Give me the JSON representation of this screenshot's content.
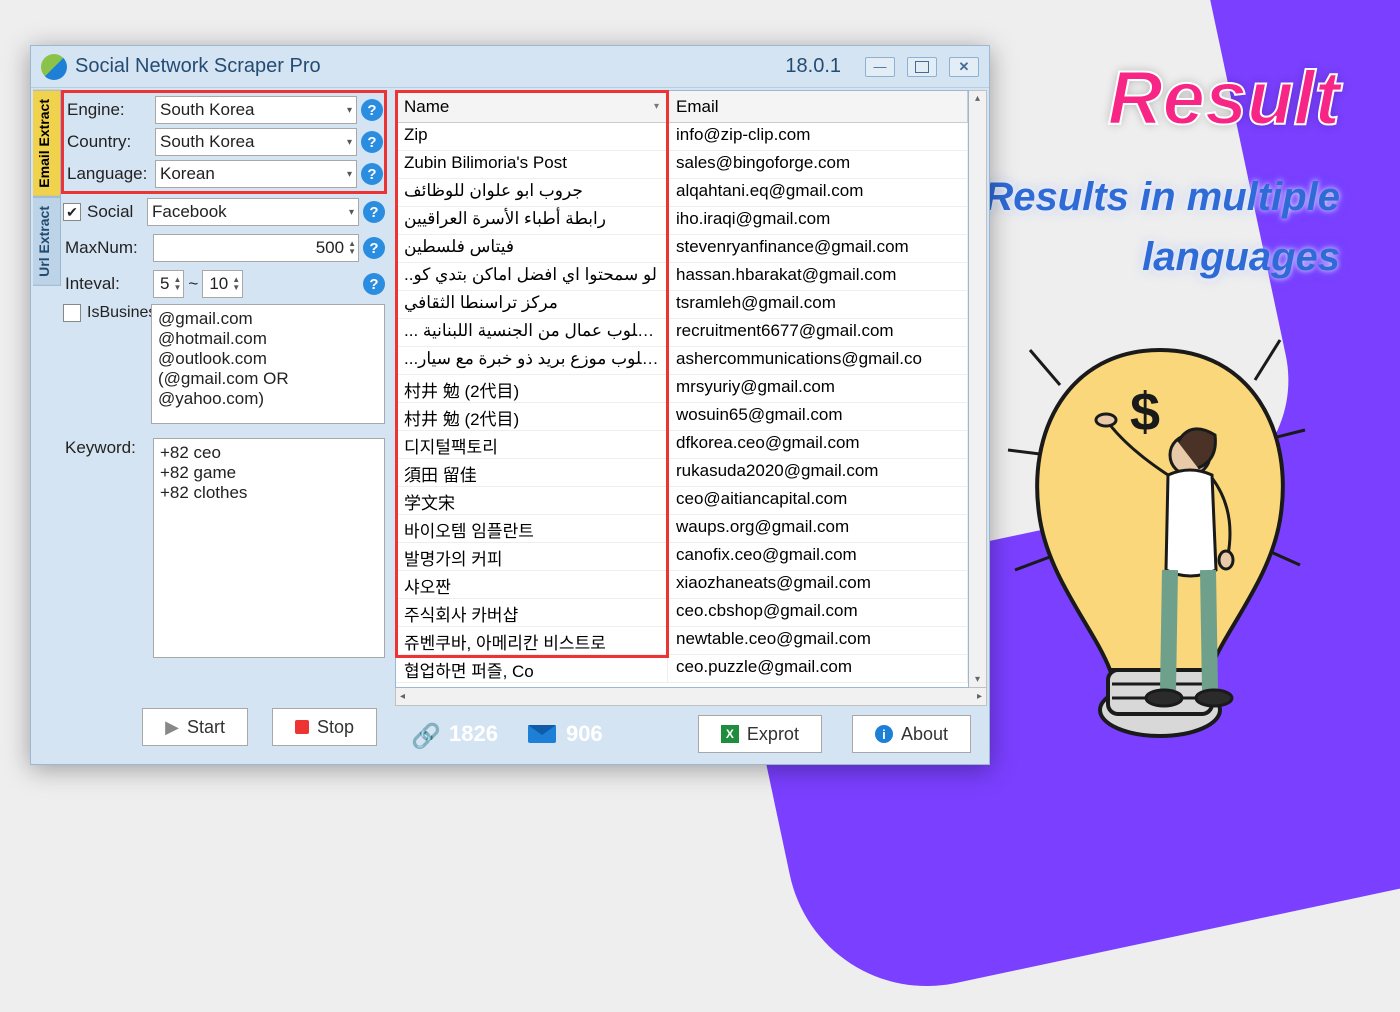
{
  "app": {
    "title": "Social Network Scraper Pro",
    "version": "18.0.1"
  },
  "promo": {
    "title": "Result",
    "sub1": "Results in multiple",
    "sub2": "languages"
  },
  "tabs": {
    "email": "Email Extract",
    "url": "Url Extract"
  },
  "form": {
    "engine_label": "Engine:",
    "engine_value": "South Korea",
    "country_label": "Country:",
    "country_value": "South Korea",
    "language_label": "Language:",
    "language_value": "Korean",
    "social_label": "Social",
    "social_value": "Facebook",
    "maxnum_label": "MaxNum:",
    "maxnum_value": "500",
    "interval_label": "Inteval:",
    "interval_from": "5",
    "interval_sep": "~",
    "interval_to": "10",
    "isbiz_label": "IsBusinessDomain",
    "domains": "@gmail.com\n@hotmail.com\n@outlook.com\n(@gmail.com OR @yahoo.com)",
    "keyword_label": "Keyword:",
    "keywords": "+82 ceo\n+82 game\n+82 clothes",
    "help": "?"
  },
  "buttons": {
    "start": "Start",
    "stop": "Stop",
    "export": "Exprot",
    "about": "About"
  },
  "grid": {
    "col_name": "Name",
    "col_email": "Email",
    "rows": [
      {
        "name": "Zip",
        "email": "info@zip-clip.com"
      },
      {
        "name": "Zubin Bilimoria's Post",
        "email": "sales@bingoforge.com"
      },
      {
        "name": "جروب ابو علوان للوظائف",
        "email": "alqahtani.eq@gmail.com"
      },
      {
        "name": "رابطة أطباء الأسرة العراقيين",
        "email": "iho.iraqi@gmail.com"
      },
      {
        "name": "فيتاس فلسطين",
        "email": "stevenryanfinance@gmail.com"
      },
      {
        "name": "..لو سمحتوا اي افضل اماكن بتدي كو",
        "email": "hassan.hbarakat@gmail.com"
      },
      {
        "name": "مركز تراسنطا الثقافي",
        "email": "tsramleh@gmail.com"
      },
      {
        "name": "... مطلوب عمال من الجنسية اللبنانية",
        "email": "recruitment6677@gmail.com"
      },
      {
        "name": "...مطلوب موزع بريد ذو خبرة مع سيار",
        "email": "ashercommunications@gmail.co"
      },
      {
        "name": "村井 勉 (2代目)",
        "email": "mrsyuriy@gmail.com"
      },
      {
        "name": "村井 勉 (2代目)",
        "email": "wosuin65@gmail.com"
      },
      {
        "name": "디지털팩토리",
        "email": "dfkorea.ceo@gmail.com"
      },
      {
        "name": "須田 留佳",
        "email": "rukasuda2020@gmail.com"
      },
      {
        "name": "学文宋",
        "email": "ceo@aitiancapital.com"
      },
      {
        "name": "바이오템 임플란트",
        "email": "waups.org@gmail.com"
      },
      {
        "name": "발명가의 커피",
        "email": "canofix.ceo@gmail.com"
      },
      {
        "name": "샤오짠",
        "email": "xiaozhaneats@gmail.com"
      },
      {
        "name": "주식회사 카버샵",
        "email": "ceo.cbshop@gmail.com"
      },
      {
        "name": "쥬벤쿠바, 아메리칸 비스트로",
        "email": "newtable.ceo@gmail.com"
      },
      {
        "name": "협업하면 퍼즐, Co",
        "email": "ceo.puzzle@gmail.com"
      }
    ]
  },
  "status": {
    "links": "1826",
    "emails": "906"
  }
}
